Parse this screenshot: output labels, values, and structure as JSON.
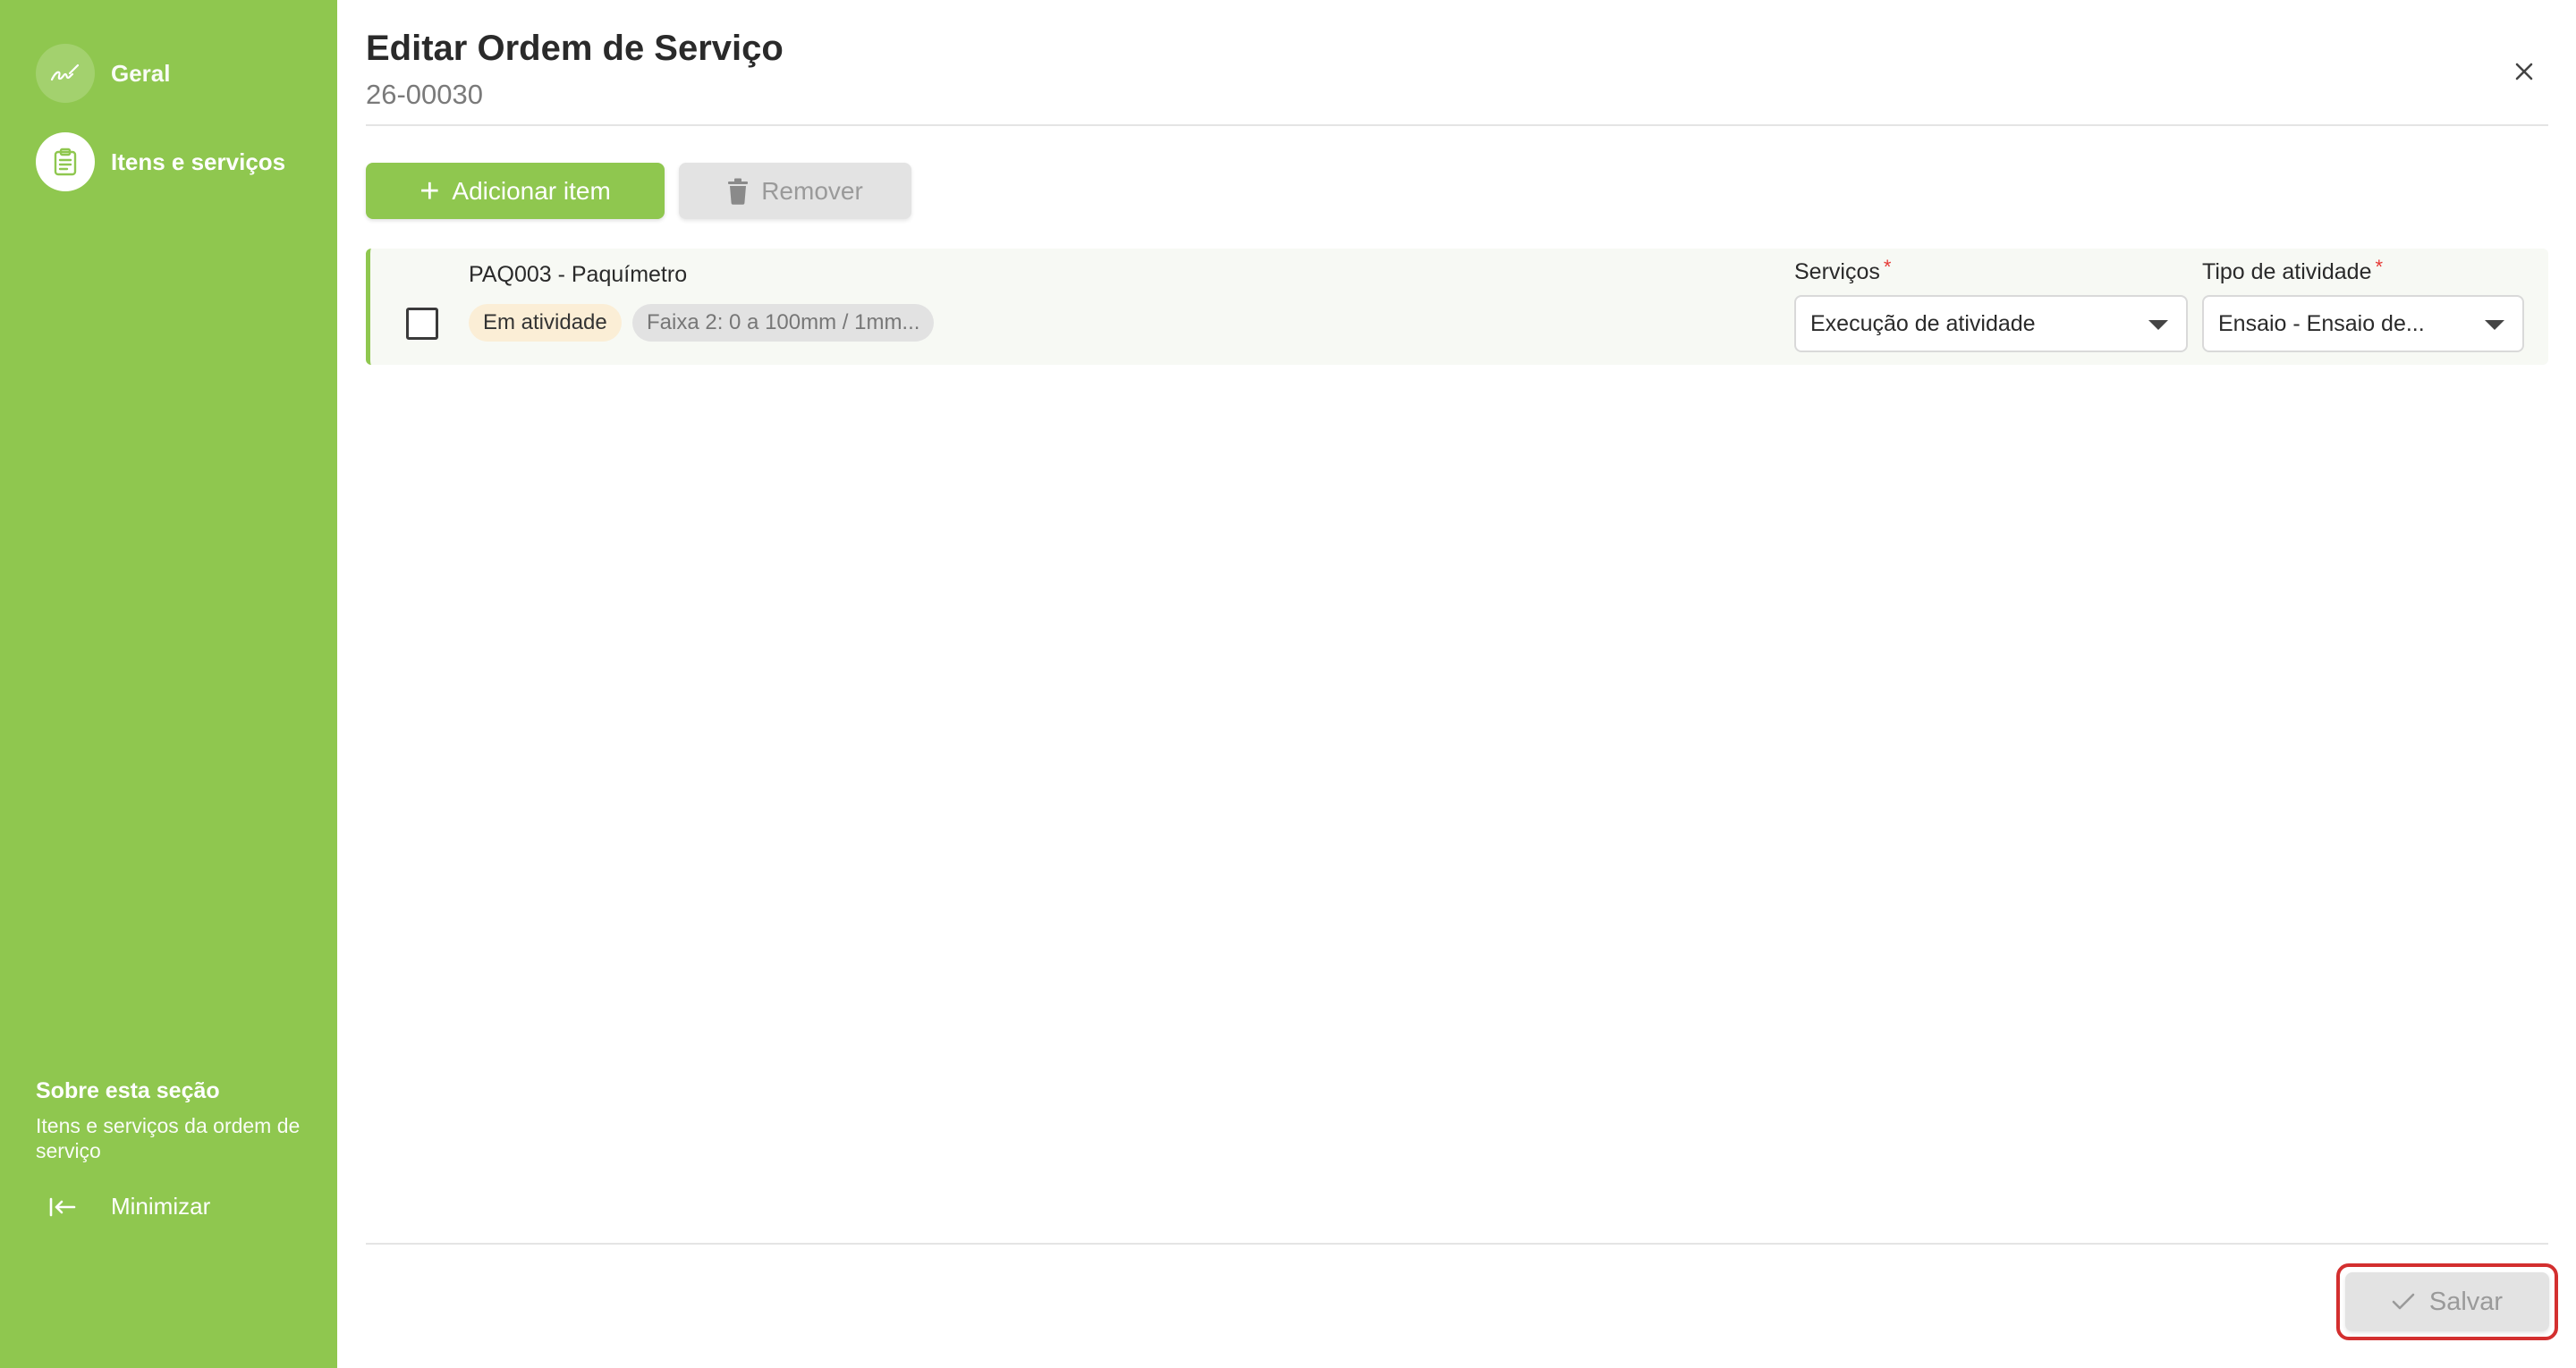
{
  "sidebar": {
    "items": [
      {
        "label": "Geral",
        "icon": "signature-icon",
        "active": false
      },
      {
        "label": "Itens e serviços",
        "icon": "clipboard-icon",
        "active": true
      }
    ],
    "about_title": "Sobre esta seção",
    "about_text": "Itens e serviços da ordem de serviço",
    "minimize_label": "Minimizar",
    "background_color": "#8fc74f"
  },
  "header": {
    "title": "Editar Ordem de Serviço",
    "subtitle": "26-00030",
    "close_icon": "close-icon"
  },
  "toolbar": {
    "add_label": "Adicionar item",
    "remove_label": "Remover"
  },
  "items": [
    {
      "name": "PAQ003 - Paquímetro",
      "status": "Em atividade",
      "range": "Faixa 2: 0 a 100mm / 1mm...",
      "checked": false,
      "servicos_label": "Serviços",
      "servicos_value": "Execução de atividade",
      "tipo_label": "Tipo de atividade",
      "tipo_value": "Ensaio - Ensaio de...",
      "required_mark": "*"
    }
  ],
  "footer": {
    "save_label": "Salvar",
    "highlight_color": "#d32f2f"
  }
}
